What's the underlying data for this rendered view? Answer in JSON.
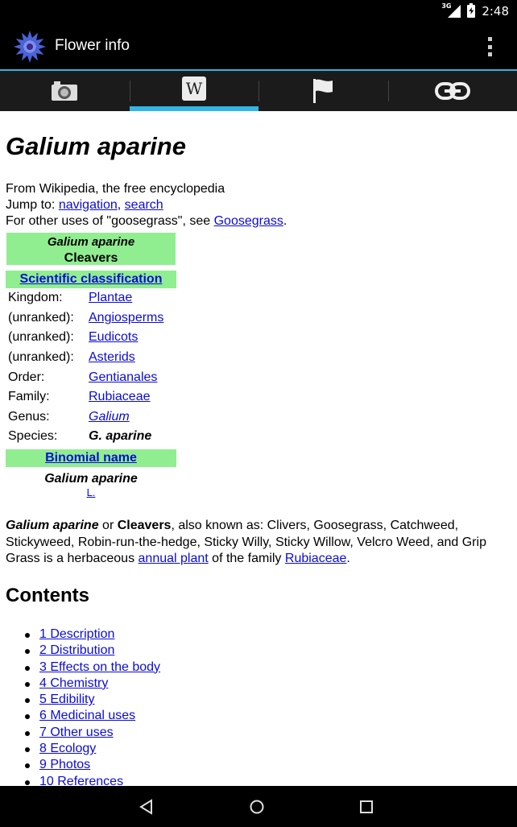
{
  "status": {
    "network": "3G",
    "time": "2:48"
  },
  "appbar": {
    "title": "Flower info"
  },
  "tabs": [
    {
      "name": "camera",
      "icon": "camera-icon",
      "active": false
    },
    {
      "name": "wikipedia",
      "icon": "wikipedia-icon",
      "active": true
    },
    {
      "name": "flag",
      "icon": "flag-icon",
      "active": false
    },
    {
      "name": "link",
      "icon": "link-icon",
      "active": false
    }
  ],
  "article": {
    "title": "Galium aparine",
    "from": "From Wikipedia, the free encyclopedia",
    "jump_to": "Jump to:",
    "jump_nav": "navigation",
    "jump_sep": ",",
    "jump_search": "search",
    "other_uses_prefix": "For other uses of \"goosegrass\", see",
    "other_uses_link": "Goosegrass",
    "other_uses_suffix": ".",
    "infobox": {
      "name": "Galium aparine",
      "common": "Cleavers",
      "classification_header": "Scientific classification",
      "rows": [
        {
          "key": "Kingdom:",
          "value": "Plantae",
          "style": "link"
        },
        {
          "key": "(unranked):",
          "value": "Angiosperms",
          "style": "link"
        },
        {
          "key": "(unranked):",
          "value": "Eudicots",
          "style": "link"
        },
        {
          "key": "(unranked):",
          "value": "Asterids",
          "style": "link"
        },
        {
          "key": "Order:",
          "value": "Gentianales",
          "style": "link"
        },
        {
          "key": "Family:",
          "value": "Rubiaceae",
          "style": "link"
        },
        {
          "key": "Genus:",
          "value": "Galium",
          "style": "italic-link"
        },
        {
          "key": "Species:",
          "value": "G. aparine",
          "style": "bold-italic"
        }
      ],
      "binomial_header": "Binomial name",
      "binomial": "Galium aparine",
      "authority": "L."
    },
    "intro": {
      "name": "Galium aparine",
      "or": "or",
      "common": "Cleavers",
      "text1": ", also known as: Clivers, Goosegrass, Catchweed, Stickyweed, Robin-run-the-hedge, Sticky Willy, Sticky Willow, Velcro Weed, and Grip Grass is a herbaceous",
      "link1": "annual plant",
      "text2": "of the family",
      "link2": "Rubiaceae",
      "end": "."
    },
    "contents_title": "Contents",
    "toc": [
      "1 Description",
      "2 Distribution",
      "3 Effects on the body",
      "4 Chemistry",
      "5 Edibility",
      "6 Medicinal uses",
      "7 Other uses",
      "8 Ecology",
      "9 Photos",
      "10 References"
    ]
  },
  "colors": {
    "accent": "#33b5e5",
    "infobox": "#90ee90",
    "link": "#0b0bd8"
  }
}
